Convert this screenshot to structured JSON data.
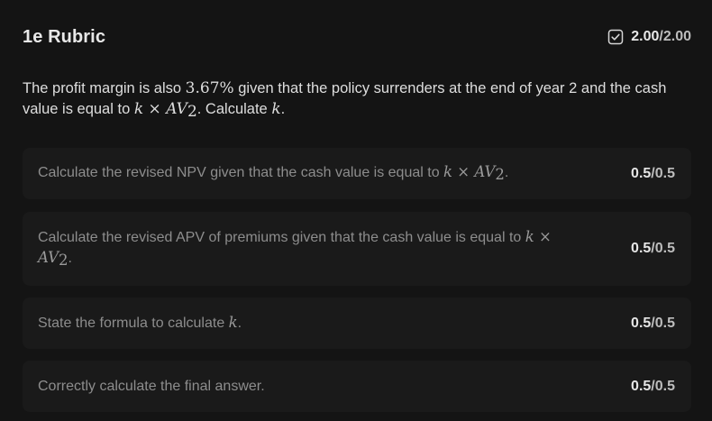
{
  "rubric": {
    "title": "1e Rubric",
    "score_earned": "2.00",
    "score_sep": "/",
    "score_total": "2.00",
    "question": {
      "part1": "The profit margin is also ",
      "math1": "3.67%",
      "part2": " given that the policy surrenders at the end of year 2 and the cash value is equal to ",
      "math2_k": "k",
      "math2_times": " × ",
      "math2_av": "AV",
      "math2_sub": "2",
      "part3": ". Calculate ",
      "math3": "k",
      "part4": "."
    }
  },
  "criteria": [
    {
      "text_before": "Calculate the revised NPV given that the cash value is equal to ",
      "math_k": "k",
      "math_times": " × ",
      "math_av": "AV",
      "math_sub": "2",
      "text_after": ".",
      "earned": "0.5",
      "sep": "/",
      "total": "0.5"
    },
    {
      "text_before": "Calculate the revised APV of premiums given that the cash value is equal to ",
      "math_k": "k",
      "math_times": " × ",
      "math_av": "AV",
      "math_sub": "2",
      "text_after": ".",
      "earned": "0.5",
      "sep": "/",
      "total": "0.5"
    },
    {
      "text_before": "State the formula to calculate ",
      "math_k": "k",
      "text_after": ".",
      "earned": "0.5",
      "sep": "/",
      "total": "0.5"
    },
    {
      "text_before": "Correctly calculate the final answer.",
      "earned": "0.5",
      "sep": "/",
      "total": "0.5"
    }
  ],
  "icons": {
    "score": "checkbox-checked-icon"
  },
  "colors": {
    "background": "#141414",
    "card": "#1a1a1a",
    "text_primary": "#e8e8e8",
    "text_muted": "#8d8d8d"
  }
}
